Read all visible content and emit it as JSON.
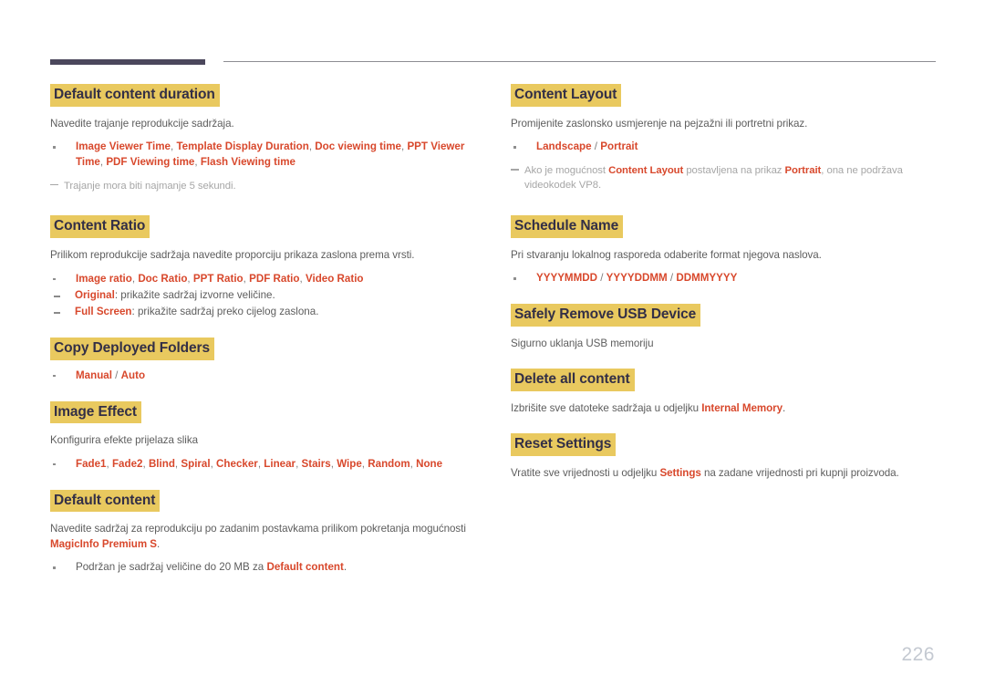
{
  "page": {
    "number": "226",
    "accent_color": "#d8482c",
    "highlight_color": "#e9c95f",
    "heading_text_color": "#332f46",
    "body_text_color": "#5d5d5d",
    "note_text_color": "#a6a6a6",
    "rule_thick_color": "#4b475c",
    "rule_thin_color": "#8d8d92"
  },
  "left_column": {
    "sections": [
      {
        "heading": "Default content duration",
        "desc": "Navedite trajanje reprodukcije sadržaja.",
        "bullet": {
          "terms": [
            "Image Viewer Time",
            "Template Display Duration",
            "Doc viewing time",
            "PPT Viewer Time",
            "PDF Viewing time",
            "Flash Viewing time"
          ],
          "separator": ", "
        },
        "note": "Trajanje mora biti najmanje 5 sekundi."
      },
      {
        "heading": "Content Ratio",
        "desc": "Prilikom reprodukcije sadržaja navedite proporciju prikaza zaslona prema vrsti.",
        "bullet": {
          "terms": [
            "Image ratio",
            "Doc Ratio",
            "PPT Ratio",
            "PDF Ratio",
            "Video Ratio"
          ],
          "separator": ", "
        },
        "subbullets": [
          {
            "term": "Original",
            "text": ": prikažite sadržaj izvorne veličine."
          },
          {
            "term": "Full Screen",
            "text": ": prikažite sadržaj preko cijelog zaslona."
          }
        ]
      },
      {
        "heading": "Copy Deployed Folders",
        "options": {
          "terms": [
            "Manual",
            "Auto"
          ],
          "separator": " / "
        }
      },
      {
        "heading": "Image Effect",
        "desc": "Konfigurira efekte prijelaza slika",
        "bullet": {
          "terms": [
            "Fade1",
            "Fade2",
            "Blind",
            "Spiral",
            "Checker",
            "Linear",
            "Stairs",
            "Wipe",
            "Random",
            "None"
          ],
          "separator": ", "
        }
      },
      {
        "heading": "Default content",
        "desc_parts": [
          {
            "t": "Navedite sadržaj za reprodukciju po zadanim postavkama prilikom pokretanja mogućnosti ",
            "style": "plain"
          },
          {
            "t": "MagicInfo Premium S",
            "style": "accent"
          },
          {
            "t": ".",
            "style": "plain"
          }
        ],
        "bullet_parts": [
          {
            "t": "Podržan je sadržaj veličine do 20 MB za ",
            "style": "plain"
          },
          {
            "t": "Default content",
            "style": "accent"
          },
          {
            "t": ".",
            "style": "plain"
          }
        ]
      }
    ]
  },
  "right_column": {
    "sections": [
      {
        "heading": "Content Layout",
        "desc": "Promijenite zaslonsko usmjerenje na pejzažni ili portretni prikaz.",
        "options": {
          "terms": [
            "Landscape",
            "Portrait"
          ],
          "separator": " / "
        },
        "note_parts": [
          {
            "t": "Ako je mogućnost ",
            "style": "plain"
          },
          {
            "t": "Content Layout",
            "style": "accent"
          },
          {
            "t": " postavljena na prikaz ",
            "style": "plain"
          },
          {
            "t": "Portrait",
            "style": "accent"
          },
          {
            "t": ", ona ne podržava videokodek VP8.",
            "style": "plain"
          }
        ]
      },
      {
        "heading": "Schedule Name",
        "desc": "Pri stvaranju lokalnog rasporeda odaberite format njegova naslova.",
        "options": {
          "terms": [
            "YYYYMMDD",
            "YYYYDDMM",
            "DDMMYYYY"
          ],
          "separator": " / "
        }
      },
      {
        "heading": "Safely Remove USB Device",
        "desc": "Sigurno uklanja USB memoriju"
      },
      {
        "heading": "Delete all content",
        "desc_parts": [
          {
            "t": "Izbrišite sve datoteke sadržaja u odjeljku ",
            "style": "plain"
          },
          {
            "t": "Internal Memory",
            "style": "accent"
          },
          {
            "t": ".",
            "style": "plain"
          }
        ]
      },
      {
        "heading": "Reset Settings",
        "desc_parts": [
          {
            "t": "Vratite sve vrijednosti u odjeljku ",
            "style": "plain"
          },
          {
            "t": "Settings",
            "style": "accent"
          },
          {
            "t": " na zadane vrijednosti pri kupnji proizvoda.",
            "style": "plain"
          }
        ]
      }
    ]
  }
}
